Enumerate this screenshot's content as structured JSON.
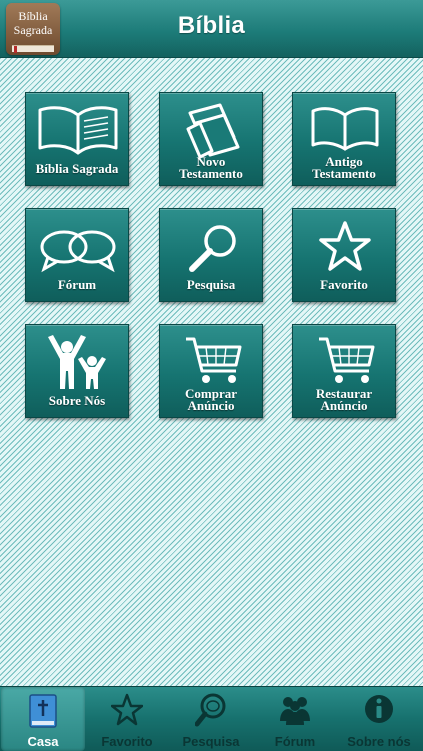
{
  "header": {
    "title": "Bíblia",
    "app_icon_line1": "Bíblia",
    "app_icon_line2": "Sagrada"
  },
  "tiles": [
    {
      "id": "biblia-sagrada",
      "icon": "open-book-icon",
      "line1": "Bíblia Sagrada",
      "line2": ""
    },
    {
      "id": "novo-testamento",
      "icon": "stacked-pages-icon",
      "line1": "Novo",
      "line2": "Testamento"
    },
    {
      "id": "antigo-testamento",
      "icon": "open-book-icon",
      "line1": "Antigo",
      "line2": "Testamento"
    },
    {
      "id": "forum",
      "icon": "speech-bubbles-icon",
      "line1": "Fórum",
      "line2": ""
    },
    {
      "id": "pesquisa",
      "icon": "magnifier-icon",
      "line1": "Pesquisa",
      "line2": ""
    },
    {
      "id": "favorito",
      "icon": "star-icon",
      "line1": "Favorito",
      "line2": ""
    },
    {
      "id": "sobre-nos",
      "icon": "people-icon",
      "line1": "Sobre Nós",
      "line2": ""
    },
    {
      "id": "comprar-anuncio",
      "icon": "shopping-cart-icon",
      "line1": "Comprar",
      "line2": "Anúncio"
    },
    {
      "id": "restaurar-anuncio",
      "icon": "shopping-cart-icon",
      "line1": "Restaurar",
      "line2": "Anúncio"
    }
  ],
  "tabbar": {
    "items": [
      {
        "label": "Casa",
        "icon": "bible-cross-icon",
        "active": true
      },
      {
        "label": "Favorito",
        "icon": "star-icon",
        "active": false
      },
      {
        "label": "Pesquisa",
        "icon": "magnifier-icon",
        "active": false
      },
      {
        "label": "Fórum",
        "icon": "people-group-icon",
        "active": false
      },
      {
        "label": "Sobre nós",
        "icon": "info-icon",
        "active": false
      }
    ]
  },
  "colors": {
    "teal_dark": "#0f5e5b",
    "teal": "#1d7c79",
    "background": "#d6f2f2"
  }
}
